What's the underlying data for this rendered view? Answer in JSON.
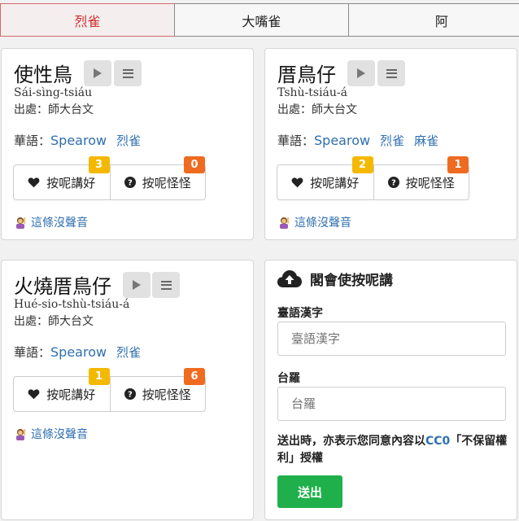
{
  "tabs": [
    {
      "label": "烈雀",
      "active": true
    },
    {
      "label": "大嘴雀",
      "active": false
    },
    {
      "label": "阿",
      "active": false
    }
  ],
  "cards": [
    {
      "title": "使性鳥",
      "romanization": "Sái-sìng-tsiáu",
      "source": "出處：師大台文",
      "huayu_label": "華語：",
      "huayu_main": "Spearow",
      "huayu_others": [
        "烈雀"
      ],
      "like_label": "按呢講好",
      "like_count": "3",
      "odd_label": "按呢怪怪",
      "odd_count": "0",
      "no_audio": "這條沒聲音"
    },
    {
      "title": "厝鳥仔",
      "romanization": "Tshù-tsiáu-á",
      "source": "出處：師大台文",
      "huayu_label": "華語：",
      "huayu_main": "Spearow",
      "huayu_others": [
        "烈雀",
        "麻雀"
      ],
      "like_label": "按呢講好",
      "like_count": "2",
      "odd_label": "按呢怪怪",
      "odd_count": "1",
      "no_audio": "這條沒聲音"
    },
    {
      "title": "火燒厝鳥仔",
      "romanization": "Hué-sio-tshù-tsiáu-á",
      "source": "出處：師大台文",
      "huayu_label": "華語：",
      "huayu_main": "Spearow",
      "huayu_others": [
        "烈雀"
      ],
      "like_label": "按呢講好",
      "like_count": "1",
      "odd_label": "按呢怪怪",
      "odd_count": "6",
      "no_audio": "這條沒聲音"
    }
  ],
  "form": {
    "title": "閣會使按呢講",
    "hanzi_label": "臺語漢字",
    "hanzi_placeholder": "臺語漢字",
    "roman_label": "台羅",
    "roman_placeholder": "台羅",
    "note_before": "送出時，亦表示您同意內容以",
    "note_link": "CC0",
    "note_after": "「不保留權利」授權",
    "submit_label": "送出"
  },
  "colors": {
    "accent_blue": "#2f6faf",
    "active_tab_red": "#d0302f",
    "badge_yellow": "#f5b800",
    "badge_orange": "#ef6b20",
    "submit_green": "#1fb04b"
  }
}
